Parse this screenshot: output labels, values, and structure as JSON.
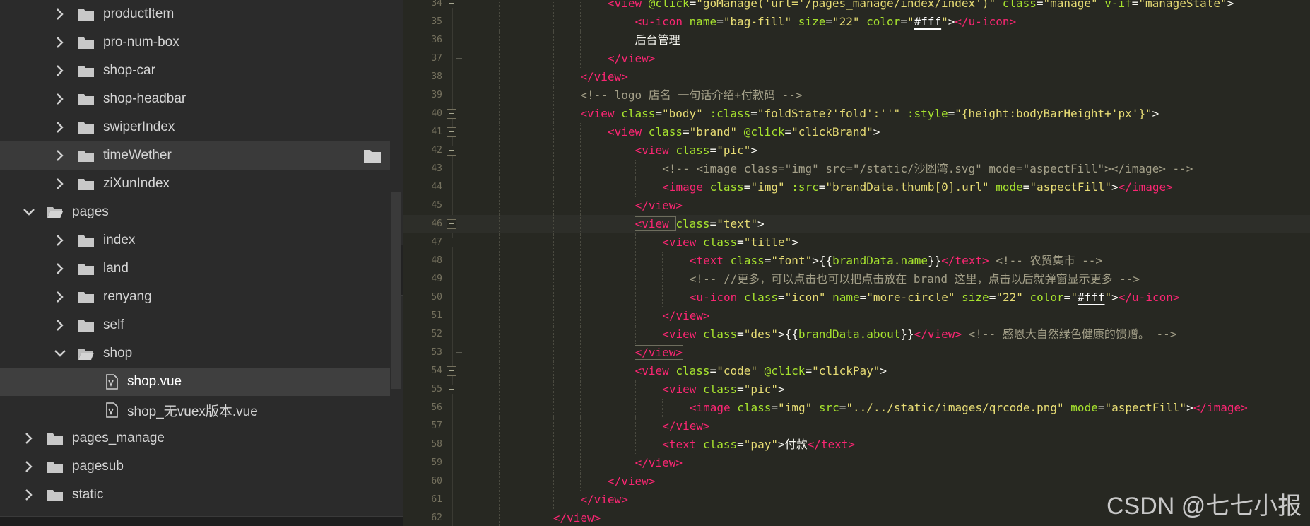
{
  "sidebar": {
    "items": [
      {
        "label": "productItem",
        "depth": 1,
        "kind": "folder",
        "expanded": false
      },
      {
        "label": "pro-num-box",
        "depth": 1,
        "kind": "folder",
        "expanded": false
      },
      {
        "label": "shop-car",
        "depth": 1,
        "kind": "folder",
        "expanded": false
      },
      {
        "label": "shop-headbar",
        "depth": 1,
        "kind": "folder",
        "expanded": false
      },
      {
        "label": "swiperIndex",
        "depth": 1,
        "kind": "folder",
        "expanded": false
      },
      {
        "label": "timeWether",
        "depth": 1,
        "kind": "folder",
        "expanded": false,
        "hover": true
      },
      {
        "label": "ziXunIndex",
        "depth": 1,
        "kind": "folder",
        "expanded": false
      },
      {
        "label": "pages",
        "depth": 0,
        "kind": "folder",
        "expanded": true
      },
      {
        "label": "index",
        "depth": 1,
        "kind": "folder",
        "expanded": false
      },
      {
        "label": "land",
        "depth": 1,
        "kind": "folder",
        "expanded": false
      },
      {
        "label": "renyang",
        "depth": 1,
        "kind": "folder",
        "expanded": false
      },
      {
        "label": "self",
        "depth": 1,
        "kind": "folder",
        "expanded": false
      },
      {
        "label": "shop",
        "depth": 1,
        "kind": "folder",
        "expanded": true
      },
      {
        "label": "shop.vue",
        "depth": 2,
        "kind": "vue-file",
        "selected": true
      },
      {
        "label": "shop_无vuex版本.vue",
        "depth": 2,
        "kind": "vue-file"
      },
      {
        "label": "pages_manage",
        "depth": 0,
        "kind": "folder",
        "expanded": false
      },
      {
        "label": "pagesub",
        "depth": 0,
        "kind": "folder",
        "expanded": false
      },
      {
        "label": "static",
        "depth": 0,
        "kind": "folder",
        "expanded": false
      }
    ]
  },
  "editor": {
    "current_line": "46",
    "lines": [
      {
        "n": "34",
        "indent": 5,
        "fold": "open",
        "tokens": [
          [
            "tag",
            "<view "
          ],
          [
            "attr",
            "@click"
          ],
          [
            "plain",
            "="
          ],
          [
            "str",
            "\"goManage('url='/pages_manage/index/index')\""
          ],
          [
            "plain",
            " "
          ],
          [
            "attr",
            "class"
          ],
          [
            "plain",
            "="
          ],
          [
            "str",
            "\"manage\""
          ],
          [
            "plain",
            " "
          ],
          [
            "attr",
            "v-if"
          ],
          [
            "plain",
            "="
          ],
          [
            "str",
            "\"manageState\""
          ],
          [
            "plain",
            ">"
          ]
        ]
      },
      {
        "n": "35",
        "indent": 6,
        "tokens": [
          [
            "tag",
            "<u-icon "
          ],
          [
            "attr",
            "name"
          ],
          [
            "plain",
            "="
          ],
          [
            "str",
            "\"bag-fill\""
          ],
          [
            "plain",
            " "
          ],
          [
            "attr",
            "size"
          ],
          [
            "plain",
            "="
          ],
          [
            "str",
            "\"22\""
          ],
          [
            "plain",
            " "
          ],
          [
            "attr",
            "color"
          ],
          [
            "plain",
            "="
          ],
          [
            "str",
            "\""
          ],
          [
            "color",
            "#fff"
          ],
          [
            "str",
            "\""
          ],
          [
            "plain",
            ">"
          ],
          [
            "tag",
            "</u-icon>"
          ]
        ]
      },
      {
        "n": "36",
        "indent": 6,
        "tokens": [
          [
            "plain",
            "后台管理"
          ]
        ]
      },
      {
        "n": "37",
        "indent": 5,
        "fold": "end",
        "tokens": [
          [
            "tag",
            "</view>"
          ]
        ]
      },
      {
        "n": "38",
        "indent": 4,
        "tokens": [
          [
            "tag",
            "</view>"
          ]
        ]
      },
      {
        "n": "39",
        "indent": 4,
        "tokens": [
          [
            "com",
            "<!-- logo 店名 一句话介绍+付款码 -->"
          ]
        ]
      },
      {
        "n": "40",
        "indent": 4,
        "fold": "open",
        "tokens": [
          [
            "tag",
            "<view "
          ],
          [
            "attr",
            "class"
          ],
          [
            "plain",
            "="
          ],
          [
            "str",
            "\"body\""
          ],
          [
            "plain",
            " "
          ],
          [
            "attr",
            ":class"
          ],
          [
            "plain",
            "="
          ],
          [
            "str",
            "\"foldState?'fold':''\""
          ],
          [
            "plain",
            " "
          ],
          [
            "attr",
            ":style"
          ],
          [
            "plain",
            "="
          ],
          [
            "str",
            "\"{height:bodyBarHeight+'px'}\""
          ],
          [
            "plain",
            ">"
          ]
        ]
      },
      {
        "n": "41",
        "indent": 5,
        "fold": "open",
        "tokens": [
          [
            "tag",
            "<view "
          ],
          [
            "attr",
            "class"
          ],
          [
            "plain",
            "="
          ],
          [
            "str",
            "\"brand\""
          ],
          [
            "plain",
            " "
          ],
          [
            "attr",
            "@click"
          ],
          [
            "plain",
            "="
          ],
          [
            "str",
            "\"clickBrand\""
          ],
          [
            "plain",
            ">"
          ]
        ]
      },
      {
        "n": "42",
        "indent": 6,
        "fold": "open",
        "tokens": [
          [
            "tag",
            "<view "
          ],
          [
            "attr",
            "class"
          ],
          [
            "plain",
            "="
          ],
          [
            "str",
            "\"pic\""
          ],
          [
            "plain",
            ">"
          ]
        ]
      },
      {
        "n": "43",
        "indent": 7,
        "tokens": [
          [
            "com",
            "<!-- <image class=\"img\" src=\"/static/沙凼湾.svg\" mode=\"aspectFill\"></image> -->"
          ]
        ]
      },
      {
        "n": "44",
        "indent": 7,
        "tokens": [
          [
            "tag",
            "<image "
          ],
          [
            "attr",
            "class"
          ],
          [
            "plain",
            "="
          ],
          [
            "str",
            "\"img\""
          ],
          [
            "plain",
            " "
          ],
          [
            "attr",
            ":src"
          ],
          [
            "plain",
            "="
          ],
          [
            "str",
            "\"brandData.thumb[0].url\""
          ],
          [
            "plain",
            " "
          ],
          [
            "attr",
            "mode"
          ],
          [
            "plain",
            "="
          ],
          [
            "str",
            "\"aspectFill\""
          ],
          [
            "plain",
            ">"
          ],
          [
            "tag",
            "</image>"
          ]
        ]
      },
      {
        "n": "45",
        "indent": 6,
        "tokens": [
          [
            "tag",
            "</view>"
          ]
        ]
      },
      {
        "n": "46",
        "indent": 6,
        "fold": "open",
        "tokens": [
          [
            "tag",
            "<view "
          ],
          [
            "attr",
            "class"
          ],
          [
            "plain",
            "="
          ],
          [
            "str",
            "\"text\""
          ],
          [
            "plain",
            ">"
          ]
        ]
      },
      {
        "n": "47",
        "indent": 7,
        "fold": "open",
        "tokens": [
          [
            "tag",
            "<view "
          ],
          [
            "attr",
            "class"
          ],
          [
            "plain",
            "="
          ],
          [
            "str",
            "\"title\""
          ],
          [
            "plain",
            ">"
          ]
        ]
      },
      {
        "n": "48",
        "indent": 8,
        "tokens": [
          [
            "tag",
            "<text "
          ],
          [
            "attr",
            "class"
          ],
          [
            "plain",
            "="
          ],
          [
            "str",
            "\"font\""
          ],
          [
            "plain",
            ">{{"
          ],
          [
            "attr",
            "brandData.name"
          ],
          [
            "plain",
            "}}"
          ],
          [
            "tag",
            "</text>"
          ],
          [
            "plain",
            " "
          ],
          [
            "com",
            "<!-- 农贸集市 -->"
          ]
        ]
      },
      {
        "n": "49",
        "indent": 8,
        "tokens": [
          [
            "com",
            "<!-- //更多，可以点击也可以把点击放在 brand 这里，点击以后就弹窗显示更多 -->"
          ]
        ]
      },
      {
        "n": "50",
        "indent": 8,
        "tokens": [
          [
            "tag",
            "<u-icon "
          ],
          [
            "attr",
            "class"
          ],
          [
            "plain",
            "="
          ],
          [
            "str",
            "\"icon\""
          ],
          [
            "plain",
            " "
          ],
          [
            "attr",
            "name"
          ],
          [
            "plain",
            "="
          ],
          [
            "str",
            "\"more-circle\""
          ],
          [
            "plain",
            " "
          ],
          [
            "attr",
            "size"
          ],
          [
            "plain",
            "="
          ],
          [
            "str",
            "\"22\""
          ],
          [
            "plain",
            " "
          ],
          [
            "attr",
            "color"
          ],
          [
            "plain",
            "="
          ],
          [
            "str",
            "\""
          ],
          [
            "color",
            "#fff"
          ],
          [
            "str",
            "\""
          ],
          [
            "plain",
            ">"
          ],
          [
            "tag",
            "</u-icon>"
          ]
        ]
      },
      {
        "n": "51",
        "indent": 7,
        "tokens": [
          [
            "tag",
            "</view>"
          ]
        ]
      },
      {
        "n": "52",
        "indent": 7,
        "tokens": [
          [
            "tag",
            "<view "
          ],
          [
            "attr",
            "class"
          ],
          [
            "plain",
            "="
          ],
          [
            "str",
            "\"des\""
          ],
          [
            "plain",
            ">{{"
          ],
          [
            "attr",
            "brandData.about"
          ],
          [
            "plain",
            "}}"
          ],
          [
            "tag",
            "</view>"
          ],
          [
            "plain",
            " "
          ],
          [
            "com",
            "<!-- 感恩大自然绿色健康的馈赠。 -->"
          ]
        ]
      },
      {
        "n": "53",
        "indent": 6,
        "fold": "end",
        "tokens": [
          [
            "tag",
            "</view>"
          ]
        ]
      },
      {
        "n": "54",
        "indent": 6,
        "fold": "open",
        "tokens": [
          [
            "tag",
            "<view "
          ],
          [
            "attr",
            "class"
          ],
          [
            "plain",
            "="
          ],
          [
            "str",
            "\"code\""
          ],
          [
            "plain",
            " "
          ],
          [
            "attr",
            "@click"
          ],
          [
            "plain",
            "="
          ],
          [
            "str",
            "\"clickPay\""
          ],
          [
            "plain",
            ">"
          ]
        ]
      },
      {
        "n": "55",
        "indent": 7,
        "fold": "open",
        "tokens": [
          [
            "tag",
            "<view "
          ],
          [
            "attr",
            "class"
          ],
          [
            "plain",
            "="
          ],
          [
            "str",
            "\"pic\""
          ],
          [
            "plain",
            ">"
          ]
        ]
      },
      {
        "n": "56",
        "indent": 8,
        "tokens": [
          [
            "tag",
            "<image "
          ],
          [
            "attr",
            "class"
          ],
          [
            "plain",
            "="
          ],
          [
            "str",
            "\"img\""
          ],
          [
            "plain",
            " "
          ],
          [
            "attr",
            "src"
          ],
          [
            "plain",
            "="
          ],
          [
            "str",
            "\"../../static/images/qrcode.png\""
          ],
          [
            "plain",
            " "
          ],
          [
            "attr",
            "mode"
          ],
          [
            "plain",
            "="
          ],
          [
            "str",
            "\"aspectFill\""
          ],
          [
            "plain",
            ">"
          ],
          [
            "tag",
            "</image>"
          ]
        ]
      },
      {
        "n": "57",
        "indent": 7,
        "tokens": [
          [
            "tag",
            "</view>"
          ]
        ]
      },
      {
        "n": "58",
        "indent": 7,
        "tokens": [
          [
            "tag",
            "<text "
          ],
          [
            "attr",
            "class"
          ],
          [
            "plain",
            "="
          ],
          [
            "str",
            "\"pay\""
          ],
          [
            "plain",
            ">付款"
          ],
          [
            "tag",
            "</text>"
          ]
        ]
      },
      {
        "n": "59",
        "indent": 6,
        "tokens": [
          [
            "tag",
            "</view>"
          ]
        ]
      },
      {
        "n": "60",
        "indent": 5,
        "tokens": [
          [
            "tag",
            "</view>"
          ]
        ]
      },
      {
        "n": "61",
        "indent": 4,
        "tokens": [
          [
            "tag",
            "</view>"
          ]
        ]
      },
      {
        "n": "62",
        "indent": 3,
        "tokens": [
          [
            "tag",
            "</view>"
          ]
        ]
      }
    ]
  },
  "watermark": "CSDN @七七小报",
  "colors": {
    "tag": "#f92672",
    "attr": "#a6e22e",
    "string": "#e6db74",
    "comment": "#a39f88",
    "editor_bg": "#272822",
    "sidebar_bg": "#2b2b2b"
  },
  "icons": [
    "chevron-right-icon",
    "chevron-down-icon",
    "folder-icon",
    "folder-open-icon",
    "vue-file-icon",
    "collapse-chevron-left-icon"
  ]
}
